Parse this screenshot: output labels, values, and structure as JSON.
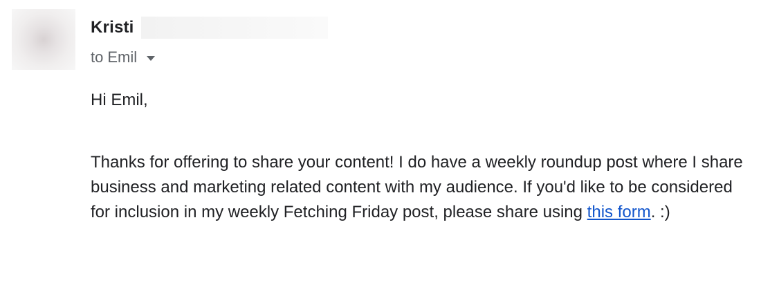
{
  "email": {
    "sender": {
      "name": "Kristi"
    },
    "recipient": {
      "prefix": "to",
      "name": "Emil"
    },
    "body": {
      "greeting": "Hi Emil,",
      "paragraph_text": "Thanks for offering to share your content! I do have a weekly roundup post where I share business and marketing related content with my audience. If you'd like to be considered for inclusion in my weekly Fetching Friday post, please share using ",
      "link_text": "this form",
      "closing": ". :)"
    }
  }
}
